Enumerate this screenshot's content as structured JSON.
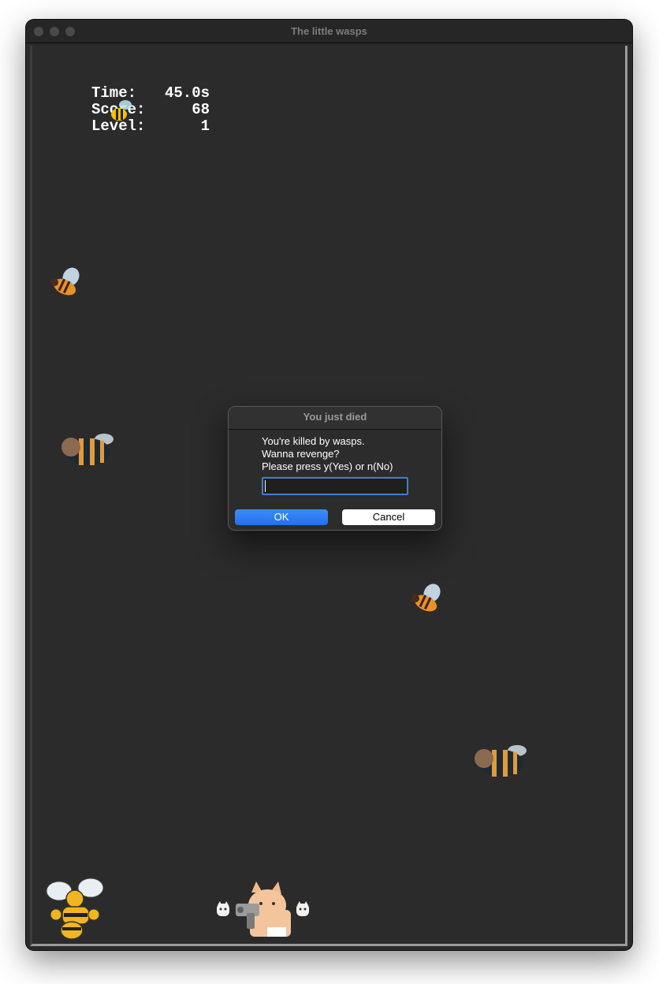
{
  "window": {
    "title": "The little wasps"
  },
  "hud": {
    "time_label": "Time:",
    "time_value": "45.0s",
    "score_label": "Score:",
    "score_value": "68",
    "level_label": "Level:",
    "level_value": "1"
  },
  "dialog": {
    "title": "You just died",
    "lines": [
      "You're killed by wasps.",
      "Wanna revenge?",
      "Please press y(Yes) or n(No)"
    ],
    "input_value": "",
    "ok_label": "OK",
    "cancel_label": "Cancel"
  },
  "colors": {
    "accent": "#2f7df5",
    "background": "#2b2b2b",
    "text": "#ffffff"
  },
  "sprites": [
    "small-bee-icon",
    "bee-icon",
    "fat-bee-icon",
    "bee-icon",
    "fat-bee-icon",
    "boss-wasp-icon",
    "gun-cat-icon",
    "ghost-cat-icon",
    "ghost-cat-icon"
  ]
}
